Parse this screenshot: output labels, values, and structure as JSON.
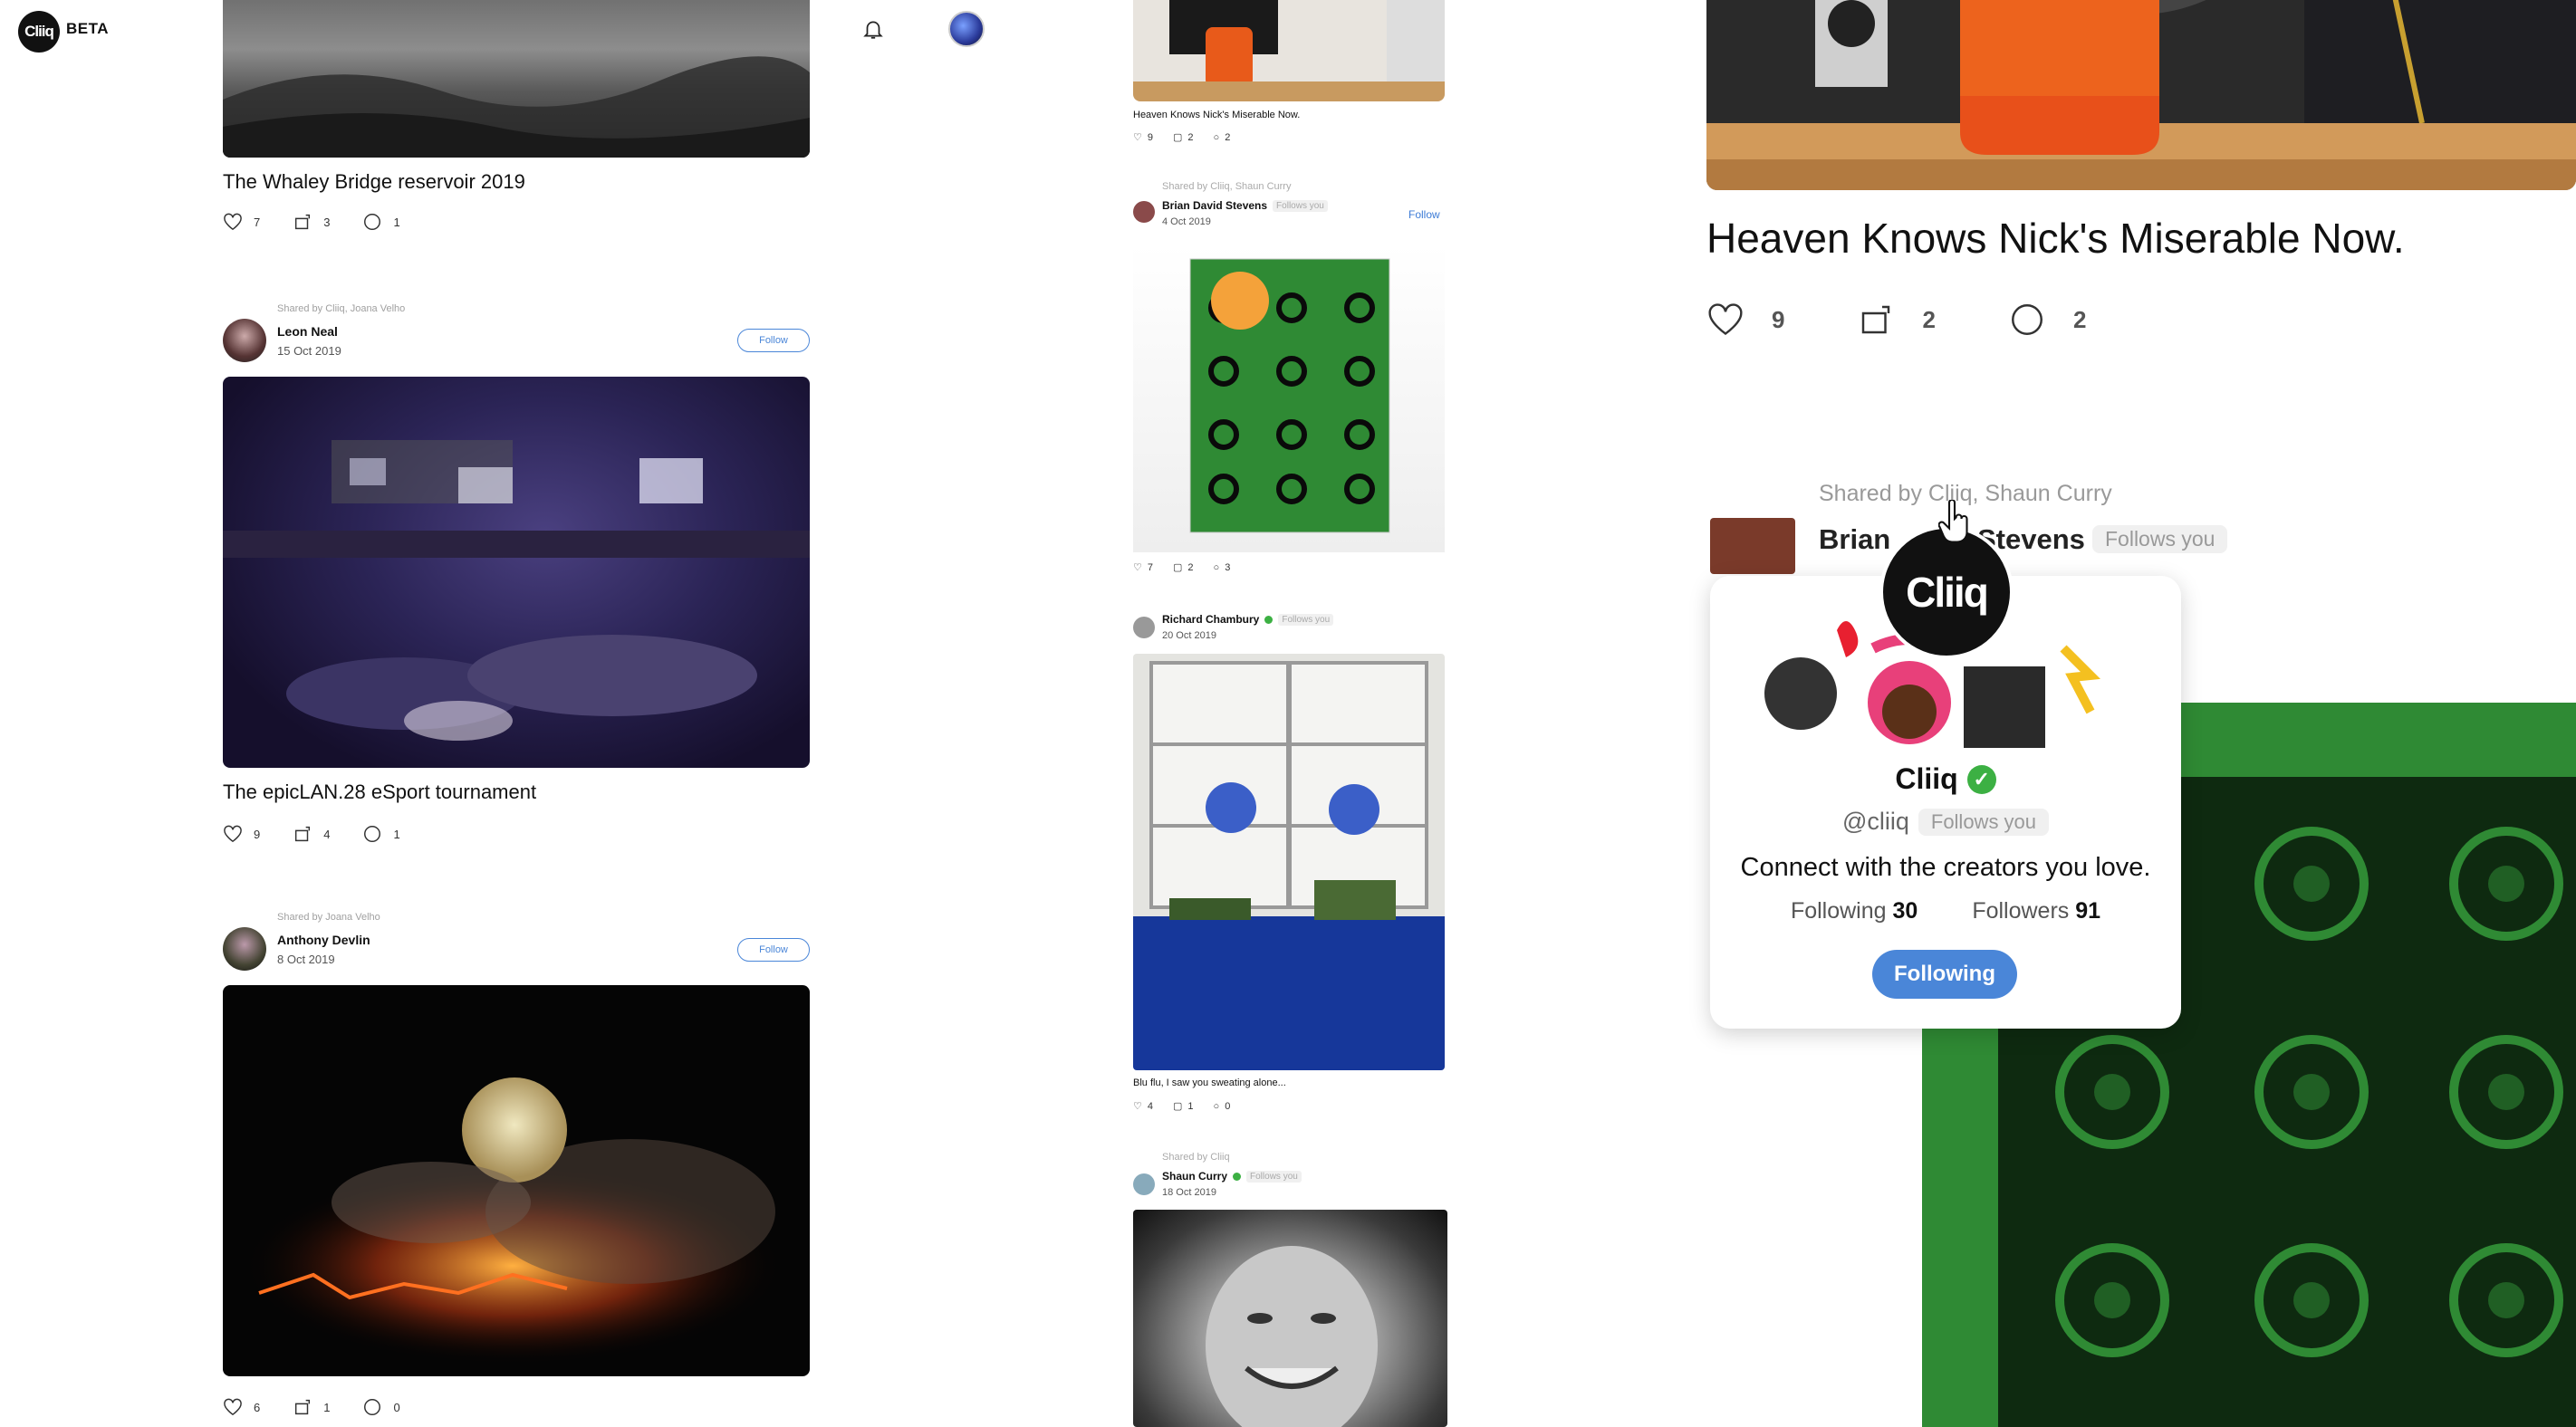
{
  "nav": {
    "logo_text": "Cliiq",
    "beta_label": "BETA",
    "icons": [
      "home-icon",
      "search-icon",
      "bell-icon",
      "avatar"
    ]
  },
  "left_feed": [
    {
      "title": "The Whaley Bridge reservoir 2019",
      "likes": "7",
      "reposts": "3",
      "comments": "1"
    },
    {
      "shared_by": "Shared by Cliiq, Joana Velho",
      "user": "Leon Neal",
      "date": "15 Oct 2019",
      "follow_label": "Follow",
      "title": "The epicLAN.28 eSport tournament",
      "likes": "9",
      "reposts": "4",
      "comments": "1"
    },
    {
      "shared_by": "Shared by Joana Velho",
      "user": "Anthony Devlin",
      "date": "8 Oct 2019",
      "follow_label": "Follow",
      "likes": "6",
      "reposts": "1",
      "comments": "0"
    }
  ],
  "mid_feed": [
    {
      "title": "Heaven Knows Nick's Miserable Now.",
      "likes": "9",
      "reposts": "2",
      "comments": "2"
    },
    {
      "shared_by": "Shared by Cliiq, Shaun Curry",
      "user": "Brian David Stevens",
      "follows_you": "Follows you",
      "date": "4 Oct 2019",
      "follow_label": "Follow",
      "likes": "7",
      "reposts": "2",
      "comments": "3"
    },
    {
      "user": "Richard Chambury",
      "follows_you": "Follows you",
      "date": "20 Oct 2019",
      "title": "Blu flu, I saw you sweating alone...",
      "likes": "4",
      "reposts": "1",
      "comments": "0"
    },
    {
      "shared_by": "Shared by Cliiq",
      "user": "Shaun Curry",
      "follows_you": "Follows you",
      "date": "18 Oct 2019"
    }
  ],
  "zoom": {
    "title": "Heaven Knows Nick's Miserable Now.",
    "likes": "9",
    "reposts": "2",
    "comments": "2",
    "shared_by": "Shared by Cliiq, Shaun Curry",
    "user_partial_a": "Brian",
    "user_partial_b": "Stevens",
    "follows_you": "Follows you"
  },
  "profile_popover": {
    "avatar_text": "Cliiq",
    "name": "Cliiq",
    "handle": "@cliiq",
    "follows_you": "Follows you",
    "bio": "Connect with the creators you love.",
    "following_label": "Following",
    "following_count": "30",
    "followers_label": "Followers",
    "followers_count": "91",
    "button_label": "Following"
  },
  "colors": {
    "accent": "#4a86d8",
    "verified": "#3cb043",
    "album_green": "#2f8a34"
  }
}
